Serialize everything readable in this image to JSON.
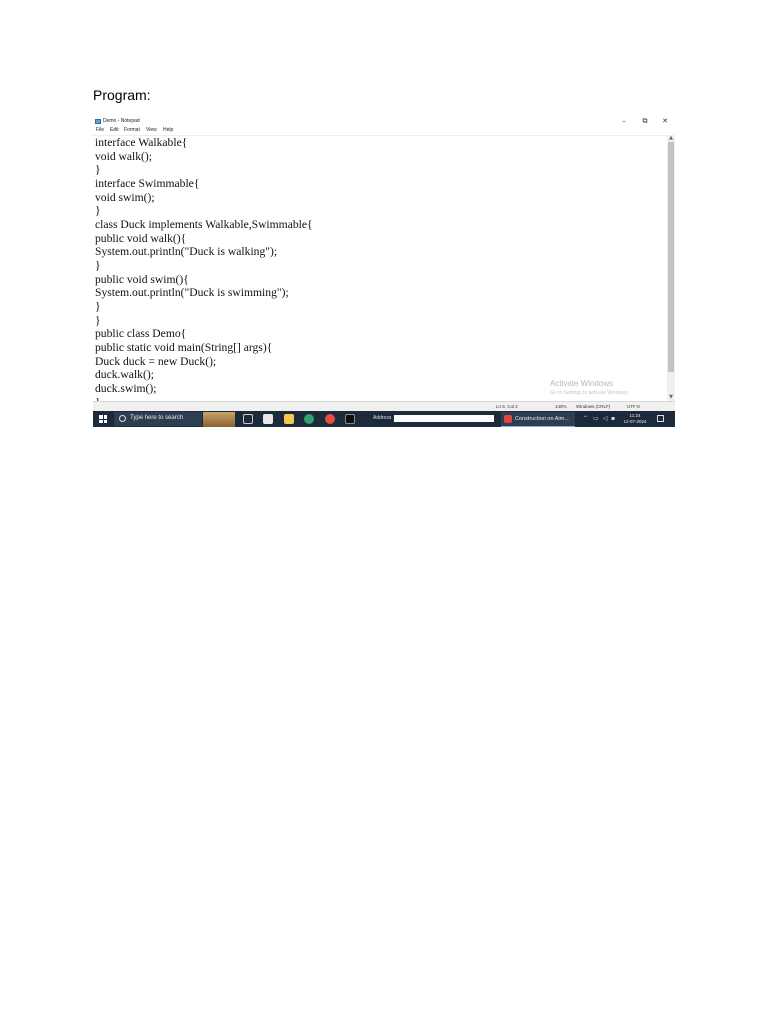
{
  "document": {
    "heading": "Program:"
  },
  "window": {
    "title": "Demo - Notepad",
    "controls": {
      "minimize": "–",
      "maximize": "⧉",
      "close": "✕"
    },
    "menu": [
      "File",
      "Edit",
      "Format",
      "View",
      "Help"
    ]
  },
  "editor": {
    "lines": [
      "interface Walkable{",
      "void walk();",
      "}",
      "interface Swimmable{",
      "void swim();",
      "}",
      "class Duck implements Walkable,Swimmable{",
      "public void walk(){",
      "System.out.println(\"Duck is walking\");",
      "}",
      "public void swim(){",
      "System.out.println(\"Duck is swimming\");",
      "}",
      "}",
      "public class Demo{",
      "public static void main(String[] args){",
      "Duck duck = new Duck();",
      "duck.walk();",
      "duck.swim();",
      "}"
    ]
  },
  "watermark": {
    "line1": "Activate Windows",
    "line2": "Go to Settings to activate Windows."
  },
  "statusbar": {
    "position": "Ln 6, Col 2",
    "zoom": "140%",
    "line_ending": "Windows (CRLF)",
    "encoding": "UTF-8"
  },
  "taskbar": {
    "search_placeholder": "Type here to search",
    "address_label": "Address",
    "address_value": "",
    "active_app": "Construction on Aim...",
    "time": "11:24",
    "date": "12-07-2024"
  }
}
